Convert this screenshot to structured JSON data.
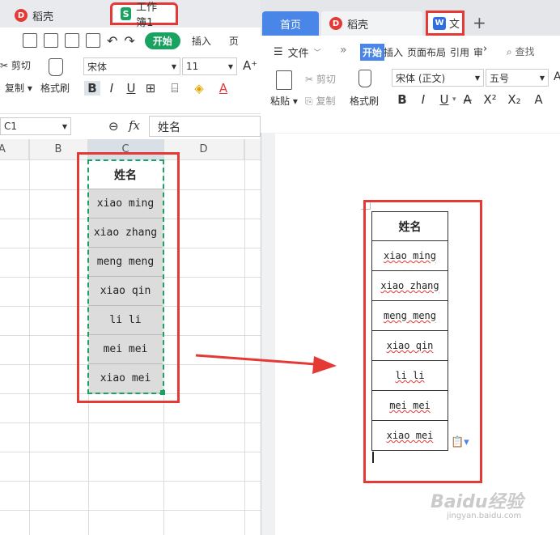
{
  "left_app": {
    "tabs": [
      {
        "label": "稻壳",
        "icon": "daoke-logo-icon"
      },
      {
        "label": "工作簿1",
        "icon": "spreadsheet-logo-icon"
      }
    ],
    "ribbon": {
      "start_label": "开始",
      "insert_label": "插入",
      "more_label": "页",
      "cut_label": "剪切",
      "copy_label": "复制",
      "format_painter_label": "格式刷",
      "font_name": "宋体",
      "font_size": "11"
    },
    "formula_bar": {
      "cell_ref": "C1",
      "fx_label": "fx",
      "value": "姓名"
    },
    "columns": [
      "A",
      "B",
      "C",
      "D"
    ],
    "cells": [
      "姓名",
      "xiao ming",
      "xiao zhang",
      "meng meng",
      "xiao qin",
      "li li",
      "mei mei",
      "xiao mei"
    ]
  },
  "right_app": {
    "tabs": [
      {
        "label": "首页"
      },
      {
        "label": "稻壳",
        "icon": "daoke-logo-icon"
      },
      {
        "label": "文",
        "icon": "writer-logo-icon"
      }
    ],
    "add_tab_label": "+",
    "menubar": {
      "file_label": "文件",
      "more_chevron": "»",
      "start_label": "开始",
      "items": [
        "插入",
        "页面布局",
        "引用",
        "审"
      ],
      "search_label": "查找"
    },
    "ribbon": {
      "paste_label": "粘贴",
      "cut_label": "剪切",
      "copy_label": "复制",
      "format_painter_label": "格式刷",
      "font_name": "宋体 (正文)",
      "font_size": "五号"
    },
    "table_rows": [
      "姓名",
      "xiao ming",
      "xiao zhang",
      "meng meng",
      "xiao qin",
      "li li",
      "mei mei",
      "xiao mei"
    ]
  },
  "watermark": {
    "text": "Baidu经验",
    "sub": "jingyan.baidu.com"
  },
  "colors": {
    "highlight": "#e53935",
    "start_green": "#1aa260",
    "home_blue": "#4a86e8"
  }
}
